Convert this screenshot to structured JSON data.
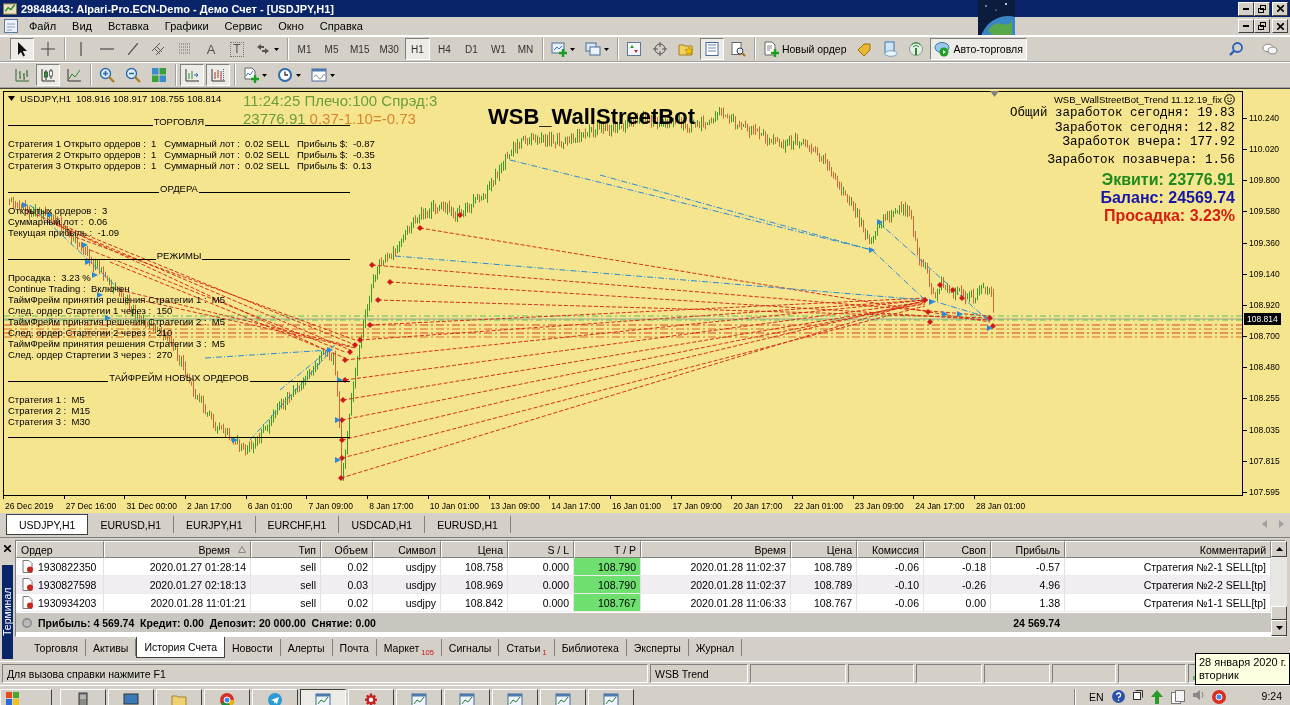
{
  "window": {
    "title": "29848443: Alpari-Pro.ECN-Demo - Демо Счет - [USDJPY,H1]"
  },
  "menu": [
    "Файл",
    "Вид",
    "Вставка",
    "Графики",
    "Сервис",
    "Окно",
    "Справка"
  ],
  "toolbar": {
    "pointer_tools": [
      {
        "kind": "cursor",
        "pressed": true
      },
      {
        "kind": "crosshair",
        "pressed": false
      }
    ],
    "drawing_tools": [
      {
        "kind": "vline",
        "pressed": false
      },
      {
        "kind": "hline",
        "pressed": false
      },
      {
        "kind": "trendline",
        "pressed": false
      },
      {
        "kind": "channel",
        "pressed": false
      },
      {
        "kind": "fibo",
        "pressed": false
      },
      {
        "kind": "text_tool",
        "text": "A",
        "pressed": false
      },
      {
        "kind": "label_tool",
        "text": "T",
        "pressed": false
      },
      {
        "kind": "arrows",
        "pressed": false
      }
    ],
    "timeframes": [
      {
        "label": "M1",
        "selected": false
      },
      {
        "label": "M5",
        "selected": false
      },
      {
        "label": "M15",
        "selected": false
      },
      {
        "label": "M30",
        "selected": false
      },
      {
        "label": "H1",
        "selected": true
      },
      {
        "label": "H4",
        "selected": false
      },
      {
        "label": "D1",
        "selected": false
      },
      {
        "label": "W1",
        "selected": false
      },
      {
        "label": "MN",
        "selected": false
      }
    ],
    "chart_tools": [
      {
        "kind": "new_chart",
        "pressed": false
      },
      {
        "kind": "profiles",
        "pressed": false
      }
    ],
    "window_tools": [
      {
        "kind": "market_watch",
        "pressed": false
      },
      {
        "kind": "data_window",
        "pressed": false
      },
      {
        "kind": "navigator",
        "pressed": false
      },
      {
        "kind": "terminal",
        "pressed": true
      },
      {
        "kind": "tester",
        "pressed": false
      }
    ],
    "trade_tools": [
      {
        "kind": "new_order",
        "text": "Новый ордер",
        "pressed": false
      },
      {
        "kind": "market",
        "pressed": false
      },
      {
        "kind": "signals",
        "pressed": false
      },
      {
        "kind": "vps",
        "pressed": false
      },
      {
        "kind": "autotrading",
        "text": "Авто-торговля",
        "pressed": true
      }
    ],
    "help_tools": [
      {
        "kind": "search",
        "pressed": false
      },
      {
        "kind": "chat",
        "pressed": false
      }
    ]
  },
  "toolbar_2": {
    "chart_types": [
      {
        "kind": "bar_chart",
        "pressed": false
      },
      {
        "kind": "candles",
        "pressed": true
      },
      {
        "kind": "line_chart",
        "pressed": false
      }
    ],
    "zoom_tools": [
      {
        "kind": "zoom_in",
        "pressed": false
      },
      {
        "kind": "zoom_out",
        "pressed": false
      },
      {
        "kind": "tile",
        "pressed": false
      }
    ],
    "scroll_tools": [
      {
        "kind": "autoscroll",
        "pressed": true
      },
      {
        "kind": "chart_shift",
        "pressed": true
      }
    ],
    "insert_tools": [
      {
        "kind": "indicators",
        "pressed": false
      },
      {
        "kind": "periods",
        "pressed": false
      },
      {
        "kind": "templates",
        "pressed": false
      }
    ]
  },
  "chart": {
    "symbol": "USDJPY,H1",
    "quotes": "108.916 108.917 108.755 108.814",
    "clock": "11:24:25 Плечо:100 Спрэд:3",
    "equity": "23776.91",
    "formula": "0.37-1.10=-0.73",
    "bot_title": "WSB_WallStreetBot",
    "panel": [
      {
        "heading": "ТОРГОВЛЯ",
        "lines": [
          "Стратегия 1 Открыто ордеров :  1   Суммарный лот :  0.02 SELL   Прибыль $:  -0.87",
          "Стратегия 2 Открыто ордеров :  1   Суммарный лот :  0.02 SELL   Прибыль $:  -0.35",
          "Стратегия 3 Открыто ордеров :  1   Суммарный лот :  0.02 SELL   Прибыль $:  0.13"
        ]
      },
      {
        "heading": "ОРДЕРА",
        "lines": [
          "Открытых ордеров :  3",
          "Суммарный лот :  0.06",
          "Текущая прибыль :  -1.09"
        ]
      },
      {
        "heading": "РЕЖИМЫ",
        "lines": [
          "Просадка :  3.23 %",
          "Continue Trading :  Включен",
          "ТаймФрейм принятия решения Стратегии 1 :  M5",
          "След. ордер Стартегии 1 через :  150",
          "ТаймФрейм принятия решения Стратегии 2 :  M5",
          "След. ордер Стартегии 2 через :  210",
          "ТаймФрейм принятия решения Стратегии 3 :  M5",
          "След. ордер Стартегии 3 через :  270"
        ]
      },
      {
        "heading": "ТАЙФРЕЙМ НОВЫХ ОРДЕРОВ",
        "lines": [
          "Стратегия 1 :  M5",
          "Стратегия 2 :  M15",
          "Стратегия 3 :  M30"
        ]
      }
    ],
    "bot_info": {
      "name": "WSB_WallStreetBot_Trend 11.12.19_fix",
      "earnings": [
        "Общий заработок сегодня: 19.83",
        "Заработок сегодня: 12.82",
        "Заработок вчера: 177.92",
        "Заработок позавчера: 1.56"
      ],
      "account": [
        {
          "text": "Эквити: 23776.91",
          "color": "#1e8a1e"
        },
        {
          "text": "Баланс: 24569.74",
          "color": "#1616a8"
        },
        {
          "text": "Просадка: 3.23%",
          "color": "#d2200e"
        }
      ]
    },
    "price_axis": {
      "labels": [
        "110.240",
        "110.020",
        "109.800",
        "109.580",
        "109.360",
        "109.140",
        "108.920",
        "108.700",
        "108.480",
        "108.255",
        "108.035",
        "107.815",
        "107.595"
      ],
      "current": "108.814"
    },
    "time_axis": {
      "labels": [
        "26 Dec 2019",
        "27 Dec 16:00",
        "31 Dec 00:00",
        "2 Jan 17:00",
        "6 Jan 01:00",
        "7 Jan 09:00",
        "8 Jan 17:00",
        "10 Jan 01:00",
        "13 Jan 09:00",
        "14 Jan 17:00",
        "16 Jan 01:00",
        "17 Jan 09:00",
        "20 Jan 17:00",
        "22 Jan 01:00",
        "23 Jan 09:00",
        "24 Jan 17:00",
        "28 Jan 01:00"
      ]
    }
  },
  "chart_tabs": [
    {
      "label": "USDJPY,H1",
      "selected": true
    },
    {
      "label": "EURUSD,H1",
      "selected": false
    },
    {
      "label": "EURJPY,H1",
      "selected": false
    },
    {
      "label": "EURCHF,H1",
      "selected": false
    },
    {
      "label": "USDCAD,H1",
      "selected": false
    },
    {
      "label": "EURUSD,H1",
      "selected": false
    }
  ],
  "terminal": {
    "label": "Терминал",
    "columns": [
      {
        "label": "Ордер",
        "sorted": false
      },
      {
        "label": "Время",
        "sorted": true
      },
      {
        "label": "Тип",
        "sorted": false
      },
      {
        "label": "Объем",
        "sorted": false
      },
      {
        "label": "Символ",
        "sorted": false
      },
      {
        "label": "Цена",
        "sorted": false
      },
      {
        "label": "S / L",
        "sorted": false
      },
      {
        "label": "T / P",
        "sorted": false
      },
      {
        "label": "Время",
        "sorted": false
      },
      {
        "label": "Цена",
        "sorted": false
      },
      {
        "label": "Комиссия",
        "sorted": false
      },
      {
        "label": "Своп",
        "sorted": false
      },
      {
        "label": "Прибыль",
        "sorted": false
      },
      {
        "label": "Комментарий",
        "sorted": false
      }
    ],
    "rows": [
      {
        "cells": [
          "1930822350",
          "2020.01.27 01:28:14",
          "sell",
          "0.02",
          "usdjpy",
          "108.758",
          "0.000",
          "108.790",
          "2020.01.28 11:02:37",
          "108.789",
          "-0.06",
          "-0.18",
          "-0.57",
          "Стратегия №2-1 SELL[tp]"
        ],
        "tp_hit": true
      },
      {
        "cells": [
          "1930827598",
          "2020.01.27 02:18:13",
          "sell",
          "0.03",
          "usdjpy",
          "108.969",
          "0.000",
          "108.790",
          "2020.01.28 11:02:37",
          "108.789",
          "-0.10",
          "-0.26",
          "4.96",
          "Стратегия №2-2 SELL[tp]"
        ],
        "tp_hit": true
      },
      {
        "cells": [
          "1930934203",
          "2020.01.28 11:01:21",
          "sell",
          "0.02",
          "usdjpy",
          "108.842",
          "0.000",
          "108.767",
          "2020.01.28 11:06:33",
          "108.767",
          "-0.06",
          "0.00",
          "1.38",
          "Стратегия №1-1 SELL[tp]"
        ],
        "tp_hit": true
      }
    ],
    "summary": {
      "text": "Прибыль: 4 569.74  Кредит: 0.00  Депозит: 20 000.00  Снятие: 0.00",
      "total": "24 569.74"
    },
    "tabs": [
      {
        "label": "Торговля",
        "selected": false
      },
      {
        "label": "Активы",
        "selected": false
      },
      {
        "label": "История Счета",
        "selected": true
      },
      {
        "label": "Новости",
        "selected": false
      },
      {
        "label": "Алерты",
        "selected": false
      },
      {
        "label": "Почта",
        "selected": false
      },
      {
        "label": "Маркет",
        "count": "105",
        "selected": false
      },
      {
        "label": "Сигналы",
        "selected": false
      },
      {
        "label": "Статьи",
        "count": "1",
        "selected": false
      },
      {
        "label": "Библиотека",
        "selected": false
      },
      {
        "label": "Эксперты",
        "selected": false
      },
      {
        "label": "Журнал",
        "selected": false
      }
    ]
  },
  "status_bar": {
    "help": "Для вызова справки нажмите F1",
    "profile": "WSB Trend"
  },
  "tooltip": {
    "date": "28 января 2020 г.",
    "weekday": "вторник"
  },
  "taskbar": {
    "apps": [
      {
        "kind": "server",
        "active": false
      },
      {
        "kind": "monitor",
        "active": false
      },
      {
        "kind": "folder",
        "active": false
      },
      {
        "kind": "round_logo",
        "active": false
      },
      {
        "kind": "paper_plane",
        "active": false
      },
      {
        "kind": "chart_window",
        "active": true
      },
      {
        "kind": "gear",
        "active": false
      },
      {
        "kind": "chart_window",
        "active": false
      },
      {
        "kind": "chart_window",
        "active": false
      },
      {
        "kind": "chart_window",
        "active": false
      },
      {
        "kind": "chart_window",
        "active": false
      },
      {
        "kind": "chart_window",
        "active": false
      }
    ],
    "language": "EN",
    "clock": "9:24"
  }
}
